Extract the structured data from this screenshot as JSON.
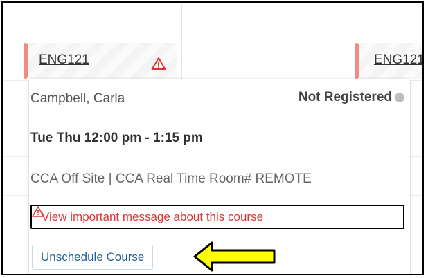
{
  "courses": [
    {
      "code": "ENG121"
    },
    {
      "code": "ENG121"
    }
  ],
  "popup": {
    "instructor": "Campbell, Carla",
    "status": "Not Registered",
    "schedule": "Tue Thu 12:00 pm - 1:15 pm",
    "location": "CCA Off Site | CCA Real Time Room# REMOTE",
    "message_link": "View important message about this course",
    "unschedule_label": "Unschedule Course"
  },
  "colors": {
    "accent_bar": "#f28b82",
    "warning": "#e03535",
    "link_blue": "#1f5f97",
    "arrow_fill": "#ffff00"
  },
  "icons": [
    "warning-triangle-icon",
    "status-dot-icon",
    "arrow-left-icon"
  ]
}
